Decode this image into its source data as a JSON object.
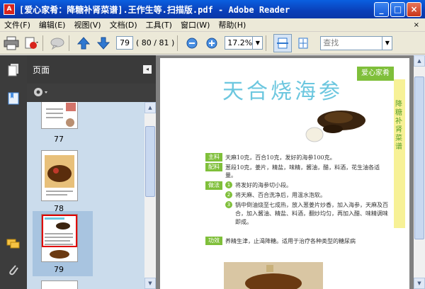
{
  "window": {
    "title": "[爱心家肴：降糖补肾菜谱].王作生等.扫描版.pdf - Adobe Reader",
    "app_icon": "adobe-reader-icon",
    "buttons": {
      "minimize": "_",
      "maximize": "□",
      "close": "×"
    }
  },
  "menu": {
    "items": [
      "文件(F)",
      "编辑(E)",
      "视图(V)",
      "文档(D)",
      "工具(T)",
      "窗口(W)",
      "帮助(H)"
    ],
    "close": "×"
  },
  "toolbar": {
    "icons": [
      "printer-icon",
      "create-pdf-icon",
      "comment-icon",
      "previous-page-icon",
      "next-page-icon",
      "zoom-out-icon",
      "zoom-in-icon",
      "fit-width-icon",
      "fit-page-icon"
    ],
    "page_current": "79",
    "page_count": "( 80 / 81 )",
    "zoom": "17.2%",
    "search_placeholder": "查找"
  },
  "nav_strip": {
    "icons": [
      "pages-icon",
      "bookmarks-icon",
      "comments-icon",
      "attachments-icon"
    ]
  },
  "panel": {
    "title": "页面",
    "collapse": "◂",
    "options_icon": "gear-icon",
    "thumbs": [
      {
        "label": "77"
      },
      {
        "label": "78"
      },
      {
        "label": "79",
        "selected": true
      },
      {
        "label": ""
      }
    ]
  },
  "document": {
    "tag": "爱心家肴",
    "recipe_title": "天合烧海参",
    "side_text": "降糖补肾菜谱",
    "sections": [
      {
        "label": "主料",
        "text": "天麻10克，百合10克，发好的海参100克。"
      },
      {
        "label": "配料",
        "text": "葱段10克，姜片，精盐，味精，酱油，醋，料酒，花生油各适量。"
      },
      {
        "label": "做法",
        "text": ""
      }
    ],
    "steps": [
      {
        "num": "1",
        "text": "将发好的海参切小段。"
      },
      {
        "num": "2",
        "text": "将天麻、百合洗净后，用温水泡软。"
      },
      {
        "num": "3",
        "text": "锅中倒油烧至七成热，放入葱姜片炒香，加入海参，天麻及百合，加入酱油、精盐、料酒，翻炒均匀，再加入醋、味精调味即成。"
      }
    ],
    "effect": {
      "label": "功效",
      "text": "养精生津，止渴降糖。适用于治疗各种类型的糖尿病"
    }
  }
}
